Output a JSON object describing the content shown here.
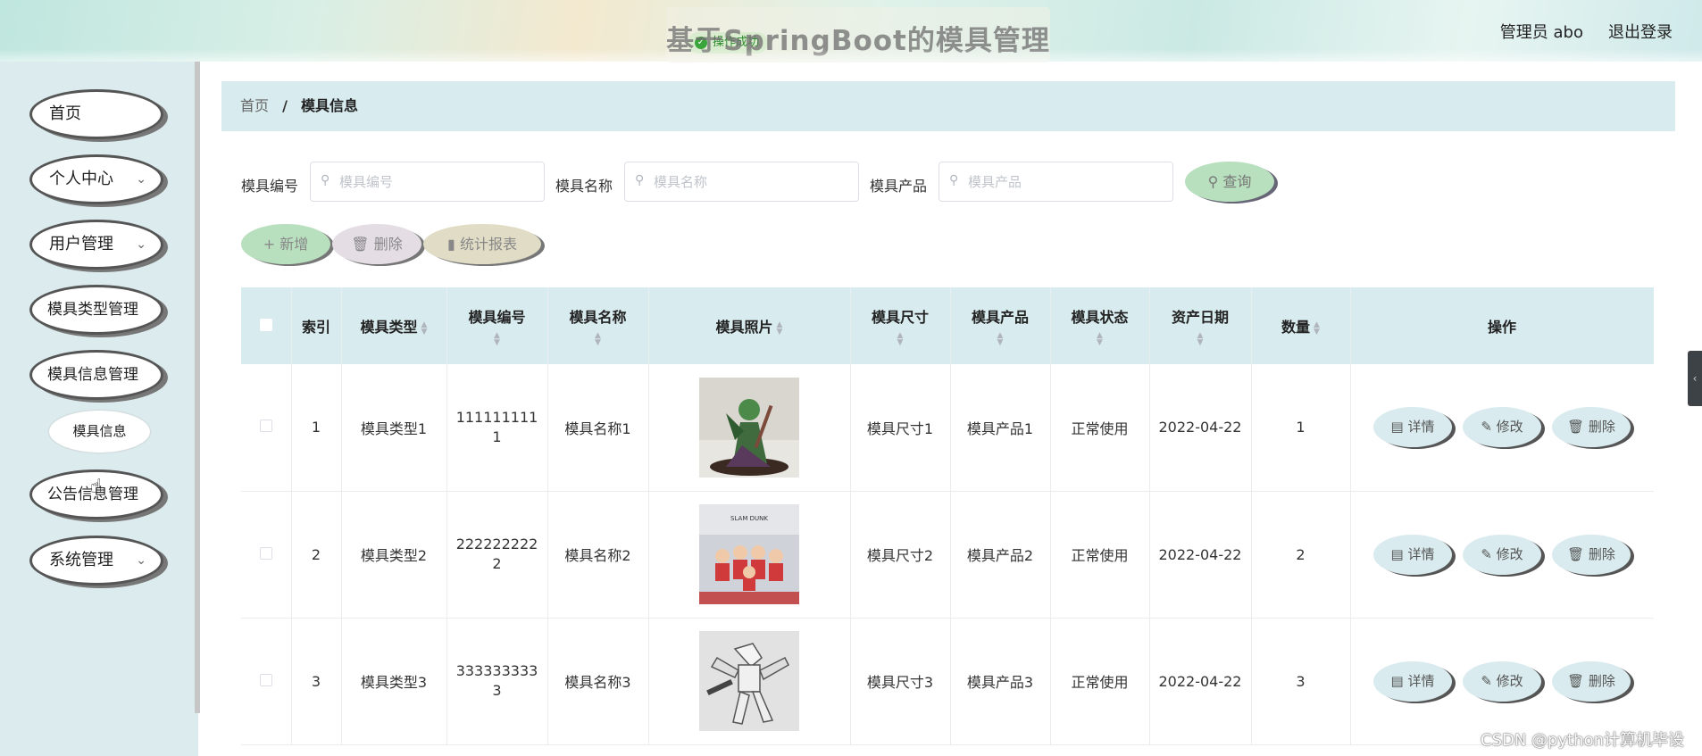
{
  "header": {
    "site_title": "基于SpringBoot的模具管理",
    "toast": "操作成功",
    "user_info": "管理员 abo",
    "logout": "退出登录"
  },
  "sidebar": {
    "items": [
      {
        "label": "首页"
      },
      {
        "label": "个人中心"
      },
      {
        "label": "用户管理"
      },
      {
        "label": "模具类型管理"
      },
      {
        "label": "模具信息管理"
      },
      {
        "label": "公告信息管理"
      },
      {
        "label": "系统管理"
      }
    ],
    "submenu_active": "模具信息"
  },
  "breadcrumb": {
    "home": "首页",
    "separator": "/",
    "current": "模具信息"
  },
  "search": {
    "fields": [
      {
        "label": "模具编号",
        "placeholder": "模具编号"
      },
      {
        "label": "模具名称",
        "placeholder": "模具名称"
      },
      {
        "label": "模具产品",
        "placeholder": "模具产品"
      }
    ],
    "query_label": "查询"
  },
  "actions": {
    "add": "新增",
    "delete": "删除",
    "report": "统计报表"
  },
  "table": {
    "headers": {
      "index": "索引",
      "type": "模具类型",
      "code": "模具编号",
      "name": "模具名称",
      "photo": "模具照片",
      "size": "模具尺寸",
      "product": "模具产品",
      "status": "模具状态",
      "date": "资产日期",
      "qty": "数量",
      "ops": "操作"
    },
    "row_actions": {
      "detail": "详情",
      "edit": "修改",
      "delete": "删除"
    },
    "rows": [
      {
        "index": "1",
        "type": "模具类型1",
        "code_a": "111111111",
        "code_b": "1",
        "name": "模具名称1",
        "size": "模具尺寸1",
        "product": "模具产品1",
        "status": "正常使用",
        "date": "2022-04-22",
        "qty": "1"
      },
      {
        "index": "2",
        "type": "模具类型2",
        "code_a": "222222222",
        "code_b": "2",
        "name": "模具名称2",
        "size": "模具尺寸2",
        "product": "模具产品2",
        "status": "正常使用",
        "date": "2022-04-22",
        "qty": "2"
      },
      {
        "index": "3",
        "type": "模具类型3",
        "code_a": "333333333",
        "code_b": "3",
        "name": "模具名称3",
        "size": "模具尺寸3",
        "product": "模具产品3",
        "status": "正常使用",
        "date": "2022-04-22",
        "qty": "3"
      }
    ]
  },
  "watermark": "CSDN @python计算机毕设",
  "colors": {
    "accent_panel": "#d8ebee",
    "query_btn": "#b8dfbe",
    "add_btn": "#b8dfbe",
    "delete_btn": "#e4dde4",
    "report_btn": "#e1dcc6"
  }
}
